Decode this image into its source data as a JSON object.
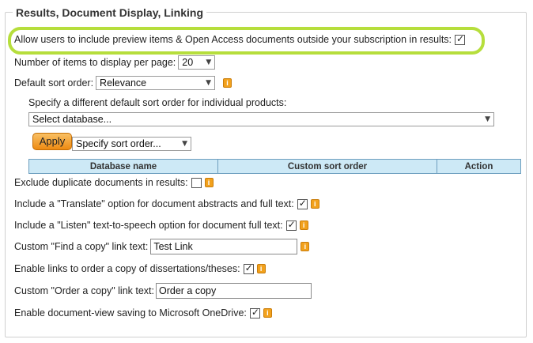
{
  "section": {
    "title": "Results, Document Display, Linking"
  },
  "preview_items": {
    "label": "Allow users to include preview items & Open Access documents outside your subscription in results:",
    "checked": true
  },
  "items_per_page": {
    "label": "Number of items to display per page:",
    "value": "20"
  },
  "default_sort": {
    "label": "Default sort order:",
    "value": "Relevance"
  },
  "product_sort": {
    "label": "Specify a different default sort order for individual products:",
    "database_select": "Select database...",
    "apply_label": "Apply",
    "sort_select": "Specify sort order..."
  },
  "table": {
    "headers": [
      "Database name",
      "Custom sort order",
      "Action"
    ]
  },
  "exclude_duplicates": {
    "label": "Exclude duplicate documents in results:",
    "checked": false
  },
  "translate_option": {
    "label": "Include a \"Translate\" option for document abstracts and full text:",
    "checked": true
  },
  "listen_option": {
    "label": "Include a \"Listen\" text-to-speech option for document full text:",
    "checked": true
  },
  "find_copy": {
    "label": "Custom \"Find a copy\" link text:",
    "value": "Test Link"
  },
  "order_links": {
    "label": "Enable links to order a copy of dissertations/theses:",
    "checked": true
  },
  "order_copy": {
    "label": "Custom \"Order a copy\" link text:",
    "value": "Order a copy"
  },
  "onedrive": {
    "label": "Enable document-view saving to Microsoft OneDrive:",
    "checked": true
  },
  "icons": {
    "info": "info-icon",
    "dropdown": "chevron-down-icon",
    "check": "checkmark-icon"
  },
  "colors": {
    "highlight": "#b6de3c",
    "info_icon": "#f2a11c",
    "apply_button": "#ee8a12",
    "table_header": "#cde9f6"
  }
}
